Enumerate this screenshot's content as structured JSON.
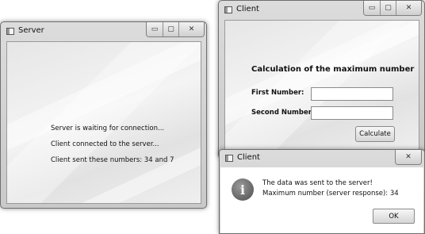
{
  "server_window": {
    "title": "Server",
    "controls": {
      "minimize": "▭",
      "maximize": "▢",
      "close": "✕"
    },
    "messages": [
      "Server is waiting for connection...",
      "Client connected to the server...",
      "Client sent these numbers: 34 and 7"
    ]
  },
  "client_window": {
    "title": "Client",
    "controls": {
      "minimize": "▭",
      "maximize": "▢",
      "close": "✕"
    },
    "heading": "Calculation of the maximum number",
    "first_label": "First Number:",
    "first_value": "",
    "second_label": "Second Number:",
    "second_value": "",
    "calculate_label": "Calculate"
  },
  "dialog": {
    "title": "Client",
    "close": "✕",
    "icon": "info-icon",
    "line1": "The data was sent to the server!",
    "line2": "Maximum number (server response): 34",
    "ok_label": "OK"
  }
}
